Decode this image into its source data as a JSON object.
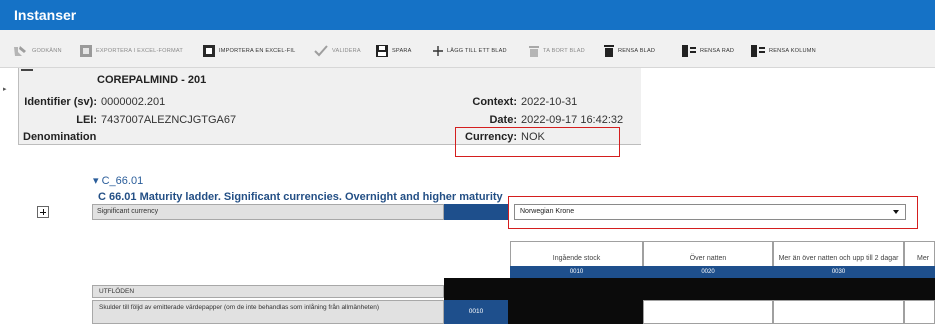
{
  "app": {
    "title": "Instanser"
  },
  "colors": {
    "titlebar": "#1572c6",
    "header_blue": "#1e4f8c",
    "highlight_red": "#d41e1e"
  },
  "toolbar": {
    "items": [
      {
        "label": "GODKÄNN",
        "icon": "approve-icon",
        "enabled": false
      },
      {
        "label": "EXPORTERA I EXCEL-FORMAT",
        "icon": "export-excel-icon",
        "enabled": false
      },
      {
        "label": "IMPORTERA EN EXCEL-FIL",
        "icon": "import-excel-icon",
        "enabled": true
      },
      {
        "label": "VALIDERA",
        "icon": "checkmark-icon",
        "enabled": false
      },
      {
        "label": "SPARA",
        "icon": "save-icon",
        "enabled": true
      },
      {
        "label": "LÄGG TILL ETT BLAD",
        "icon": "plus-icon",
        "enabled": true
      },
      {
        "label": "TA BORT BLAD",
        "icon": "trash-icon",
        "enabled": false
      },
      {
        "label": "RENSA BLAD",
        "icon": "clear-sheet-icon",
        "enabled": true
      },
      {
        "label": "RENSA RAD",
        "icon": "clear-row-icon",
        "enabled": true
      },
      {
        "label": "RENSA KOLUMN",
        "icon": "clear-column-icon",
        "enabled": true
      }
    ]
  },
  "info": {
    "name": "COREPALMIND - 201",
    "identifier_label": "Identifier (sv):",
    "identifier_value": "0000002.201",
    "lei_label": "LEI:",
    "lei_value": "7437007ALEZNCJGTGA67",
    "denomination_label": "Denomination",
    "context_label": "Context:",
    "context_value": "2022-10-31",
    "date_label": "Date:",
    "date_value": "2022-09-17 16:42:32",
    "currency_label": "Currency:",
    "currency_value": "NOK"
  },
  "section": {
    "toggle": "C_66.01",
    "title": "C 66.01 Maturity ladder. Significant currencies. Overnight and higher maturity",
    "significant_currency_label": "Significant currency",
    "selected_currency": "Norwegian Krone"
  },
  "table": {
    "columns": [
      {
        "label": "Ingående stock",
        "code": "0010"
      },
      {
        "label": "Över natten",
        "code": "0020"
      },
      {
        "label": "Mer än över natten och upp till 2 dagar",
        "code": "0030"
      },
      {
        "label": "Mer",
        "code": ""
      }
    ],
    "group_header": "UTFLÖDEN",
    "rows": [
      {
        "label": "Skulder till följd av emitterade värdepapper (om de inte behandlas som inlåning från allmänheten)",
        "code": "0010"
      }
    ]
  }
}
